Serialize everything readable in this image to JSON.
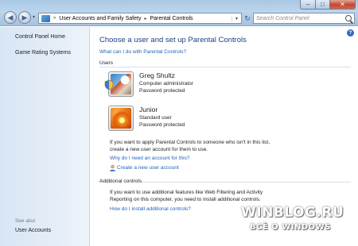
{
  "window": {
    "minimize_glyph": "–",
    "maximize_glyph": "□",
    "close_glyph": "✕"
  },
  "nav": {
    "back_glyph": "◀",
    "forward_glyph": "▶",
    "dropdown_glyph": "▾"
  },
  "address": {
    "separator": "«",
    "path_1": "User Accounts and Family Safety",
    "path_arrow": "▸",
    "path_2": "Parental Controls",
    "caret": "▾"
  },
  "refresh_glyph": "↻",
  "search": {
    "placeholder": "Search Control Panel"
  },
  "sidebar": {
    "items": [
      {
        "label": "Control Panel Home"
      },
      {
        "label": "Game Rating Systems"
      }
    ],
    "see_also_title": "See also",
    "see_also_items": [
      {
        "label": "User Accounts"
      }
    ]
  },
  "main": {
    "help_glyph": "?",
    "heading": "Choose a user and set up Parental Controls",
    "what_link": "What can I do with Parental Controls?",
    "users_section": "Users",
    "users": [
      {
        "name": "Greg Shultz",
        "role": "Computer administrator",
        "status": "Password protected",
        "avatar": "chess-avatar"
      },
      {
        "name": "Junior",
        "role": "Standard user",
        "status": "Password protected",
        "avatar": "flower-avatar"
      }
    ],
    "apply_text_1": "If you want to apply Parental Controls to someone who isn't in this list,",
    "apply_text_2": "create a new user account for them to use.",
    "why_link": "Why do I need an account for this?",
    "create_link": "Create a new user account",
    "additional_section": "Additional controls",
    "additional_text_1": "If you want to use additional features like Web Filtering and Activity",
    "additional_text_2": "Reporting on this computer, you need to install additional controls.",
    "install_link": "How do I install additional controls?"
  },
  "watermark": {
    "line1": "WINBLOG.RU",
    "line2": "ВСЁ О WINDOWS"
  },
  "colors": {
    "link": "#1f63b9",
    "heading": "#1c3f85",
    "sidebar_bg": "#dfeaf6"
  }
}
